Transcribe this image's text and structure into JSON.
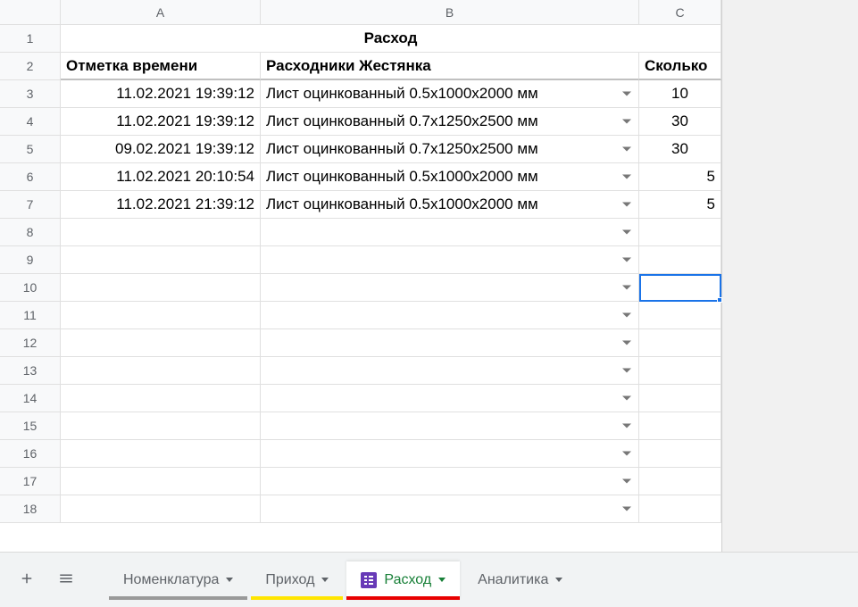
{
  "columns": [
    "A",
    "B",
    "C"
  ],
  "title": "Расход",
  "headers": {
    "A": "Отметка времени",
    "B": "Расходники Жестянка",
    "C": "Сколько"
  },
  "rows": [
    {
      "A": "11.02.2021 19:39:12",
      "B": "Лист оцинкованный 0.5х1000х2000 мм",
      "C": "10",
      "C_align": "center"
    },
    {
      "A": "11.02.2021 19:39:12",
      "B": "Лист оцинкованный 0.7х1250х2500 мм",
      "C": "30",
      "C_align": "center"
    },
    {
      "A": "09.02.2021 19:39:12",
      "B": "Лист оцинкованный 0.7х1250х2500 мм",
      "C": "30",
      "C_align": "center"
    },
    {
      "A": "11.02.2021 20:10:54",
      "B": "Лист оцинкованный 0.5х1000х2000 мм",
      "C": "5",
      "C_align": "right"
    },
    {
      "A": "11.02.2021 21:39:12",
      "B": "Лист оцинкованный 0.5х1000х2000 мм",
      "C": "5",
      "C_align": "right"
    },
    {
      "A": "",
      "B": "",
      "C": ""
    },
    {
      "A": "",
      "B": "",
      "C": ""
    },
    {
      "A": "",
      "B": "",
      "C": ""
    },
    {
      "A": "",
      "B": "",
      "C": ""
    },
    {
      "A": "",
      "B": "",
      "C": ""
    },
    {
      "A": "",
      "B": "",
      "C": ""
    },
    {
      "A": "",
      "B": "",
      "C": ""
    },
    {
      "A": "",
      "B": "",
      "C": ""
    },
    {
      "A": "",
      "B": "",
      "C": ""
    },
    {
      "A": "",
      "B": "",
      "C": ""
    },
    {
      "A": "",
      "B": "",
      "C": ""
    }
  ],
  "active_cell": "C10",
  "tabs": {
    "nomen": "Номенклатура",
    "prihod": "Приход",
    "rashod": "Расход",
    "analitika": "Аналитика"
  }
}
